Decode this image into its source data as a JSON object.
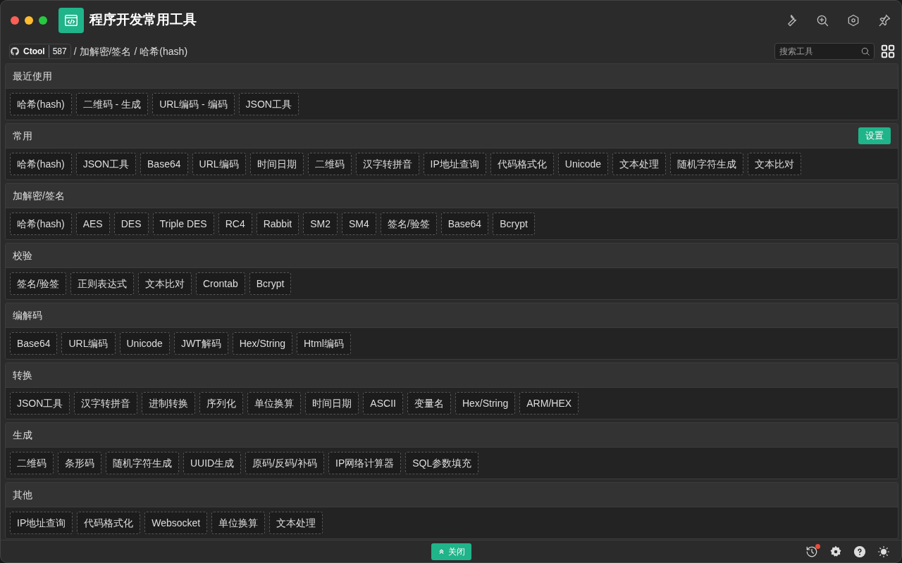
{
  "window": {
    "title": "程序开发常用工具"
  },
  "breadcrumb": {
    "repo": "Ctool",
    "stars": "587",
    "separator": "/",
    "path": [
      "加解密/签名",
      "哈希(hash)"
    ]
  },
  "search": {
    "placeholder": "搜索工具"
  },
  "sections": [
    {
      "title": "最近使用",
      "items": [
        "哈希(hash)",
        "二维码 - 生成",
        "URL编码 - 编码",
        "JSON工具"
      ]
    },
    {
      "title": "常用",
      "action": "设置",
      "items": [
        "哈希(hash)",
        "JSON工具",
        "Base64",
        "URL编码",
        "时间日期",
        "二维码",
        "汉字转拼音",
        "IP地址查询",
        "代码格式化",
        "Unicode",
        "文本处理",
        "随机字符生成",
        "文本比对"
      ]
    },
    {
      "title": "加解密/签名",
      "items": [
        "哈希(hash)",
        "AES",
        "DES",
        "Triple DES",
        "RC4",
        "Rabbit",
        "SM2",
        "SM4",
        "签名/验签",
        "Base64",
        "Bcrypt"
      ]
    },
    {
      "title": "校验",
      "items": [
        "签名/验签",
        "正则表达式",
        "文本比对",
        "Crontab",
        "Bcrypt"
      ]
    },
    {
      "title": "编解码",
      "items": [
        "Base64",
        "URL编码",
        "Unicode",
        "JWT解码",
        "Hex/String",
        "Html编码"
      ]
    },
    {
      "title": "转换",
      "items": [
        "JSON工具",
        "汉字转拼音",
        "进制转换",
        "序列化",
        "单位换算",
        "时间日期",
        "ASCII",
        "变量名",
        "Hex/String",
        "ARM/HEX"
      ]
    },
    {
      "title": "生成",
      "items": [
        "二维码",
        "条形码",
        "随机字符生成",
        "UUID生成",
        "原码/反码/补码",
        "IP网络计算器",
        "SQL参数填充"
      ]
    },
    {
      "title": "其他",
      "items": [
        "IP地址查询",
        "代码格式化",
        "Websocket",
        "单位换算",
        "文本处理"
      ]
    }
  ],
  "footer": {
    "close_label": "关闭",
    "history_notification": true
  }
}
